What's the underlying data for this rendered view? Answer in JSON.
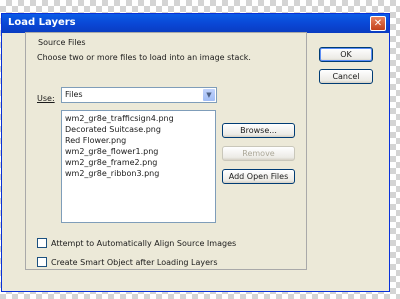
{
  "dialog": {
    "title": "Load Layers",
    "close_label": "✕"
  },
  "source_files": {
    "legend": "Source Files",
    "description": "Choose two or more files to load into an image stack.",
    "use_label": "Use:",
    "use_value": "Files",
    "files": [
      "wm2_gr8e_trafficsign4.png",
      "Decorated Suitcase.png",
      "Red Flower.png",
      "wm2_gr8e_flower1.png",
      "wm2_gr8e_frame2.png",
      "wm2_gr8e_ribbon3.png"
    ],
    "browse_label": "Browse...",
    "remove_label": "Remove",
    "add_open_label": "Add Open Files"
  },
  "options": {
    "align_label": "Attempt to Automatically Align Source Images",
    "align_checked": false,
    "smart_object_label": "Create Smart Object after Loading Layers",
    "smart_object_checked": false
  },
  "buttons": {
    "ok_label": "OK",
    "cancel_label": "Cancel"
  },
  "icons": {
    "close": "close-icon",
    "dropdown": "chevron-down-icon"
  }
}
